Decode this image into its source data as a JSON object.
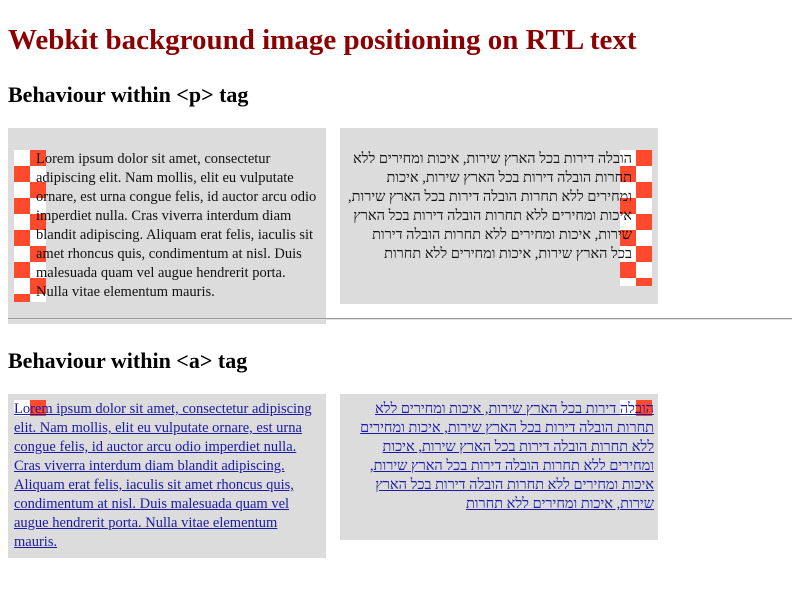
{
  "page": {
    "title": "Webkit background image positioning on RTL text"
  },
  "sections": {
    "p_heading": "Behaviour within <p> tag",
    "a_heading": "Behaviour within <a> tag"
  },
  "paragraphs": {
    "ltr_text": "Lorem ipsum dolor sit amet, consectetur adipiscing elit. Nam mollis, elit eu vulputate ornare, est urna congue felis, id auctor arcu odio imperdiet nulla. Cras viverra interdum diam blandit adipiscing. Aliquam erat felis, iaculis sit amet rhoncus quis, condimentum at nisl. Duis malesuada quam vel augue hendrerit porta. Nulla vitae elementum mauris.",
    "rtl_text": "הובלה דירות בכל הארץ שירות, איכות ומחירים ללא תחרות הובלה דירות בכל הארץ שירות, איכות ומחירים ללא תחרות הובלה דירות בכל הארץ שירות, איכות ומחירים ללא תחרות הובלה דירות בכל הארץ שירות, איכות ומחירים ללא תחרות הובלה דירות בכל הארץ שירות, איכות ומחירים ללא תחרות"
  },
  "links": {
    "ltr_text": "Lorem ipsum dolor sit amet, consectetur adipiscing elit. Nam mollis, elit eu vulputate ornare, est urna congue felis, id auctor arcu odio imperdiet nulla. Cras viverra interdum diam blandit adipiscing. Aliquam erat felis, iaculis sit amet rhoncus quis, condimentum at nisl. Duis malesuada quam vel augue hendrerit porta. Nulla vitae elementum mauris.",
    "rtl_text": "הובלה דירות בכל הארץ שירות, איכות ומחירים ללא תחרות הובלה דירות בכל הארץ שירות, איכות ומחירים ללא תחרות הובלה דירות בכל הארץ שירות, איכות ומחירים ללא תחרות הובלה דירות בכל הארץ שירות, איכות ומחירים ללא תחרות הובלה דירות בכל הארץ שירות, איכות ומחירים ללא תחרות"
  },
  "colors": {
    "heading": "#8b0000",
    "box_background": "#dcdcdc",
    "checker_red": "#ff4a2e",
    "link": "#1a1aa6"
  }
}
